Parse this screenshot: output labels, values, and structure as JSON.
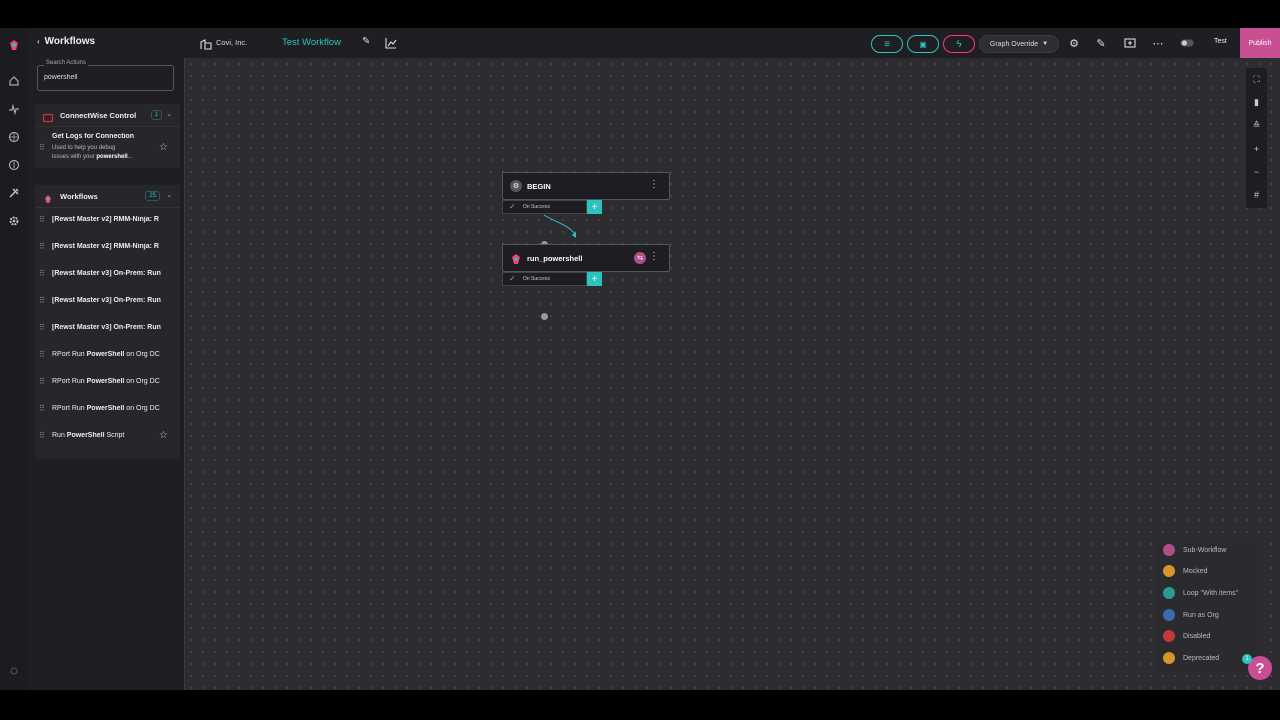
{
  "sidebar": {
    "title": "Workflows",
    "search": {
      "legend": "Search Actions",
      "value": "powershell"
    },
    "groups": [
      {
        "label": "ConnectWise Control",
        "count": "1",
        "items": [
          {
            "title": "Get Logs for Connection",
            "desc_prefix": "Used to help you debug",
            "desc_line2_prefix": "issues with your ",
            "desc_bold": "powershell",
            "desc_suffix": "..."
          }
        ]
      },
      {
        "label": "Workflows",
        "count": "25",
        "items": [
          {
            "pre": "[Rewst Master v2] RMM-Ninja: R",
            "bold": "",
            "post": ""
          },
          {
            "pre": "[Rewst Master v2] RMM-Ninja: R",
            "bold": "",
            "post": ""
          },
          {
            "pre": "[Rewst Master v3] On-Prem: Run",
            "bold": "",
            "post": ""
          },
          {
            "pre": "[Rewst Master v3] On-Prem: Run",
            "bold": "",
            "post": ""
          },
          {
            "pre": "[Rewst Master v3] On-Prem: Run",
            "bold": "",
            "post": ""
          },
          {
            "pre": "RPort Run ",
            "bold": "PowerShell",
            "post": " on Org DC"
          },
          {
            "pre": "RPort Run ",
            "bold": "PowerShell",
            "post": " on Org DC"
          },
          {
            "pre": "RPort Run ",
            "bold": "PowerShell",
            "post": " on Org DC"
          },
          {
            "pre": "Run ",
            "bold": "PowerShell",
            "post": " Script"
          }
        ]
      }
    ]
  },
  "topbar": {
    "org_name": "Covi, Inc.",
    "workflow_name": "Test Workflow",
    "graph_override_label": "Graph Override",
    "test_label": "Test",
    "publish_label": "Publish"
  },
  "canvas": {
    "nodes": [
      {
        "title": "BEGIN",
        "port_label": "On Success"
      },
      {
        "title": "run_powershell",
        "port_label": "On Success"
      }
    ]
  },
  "legend": [
    {
      "label": "Sub-Workflow",
      "color": "#b0508a"
    },
    {
      "label": "Mocked",
      "color": "#d6952a"
    },
    {
      "label": "Loop \"With items\"",
      "color": "#2a9a98"
    },
    {
      "label": "Run as Org",
      "color": "#3a6ab0"
    },
    {
      "label": "Disabled",
      "color": "#c03a3a"
    },
    {
      "label": "Deprecated",
      "color": "#d6952a"
    }
  ],
  "help": {
    "label": "?",
    "badge": "1"
  },
  "colors": {
    "accent": "#2bc3c0",
    "publish": "#c84f92",
    "trigger": "#ff3a6e"
  }
}
